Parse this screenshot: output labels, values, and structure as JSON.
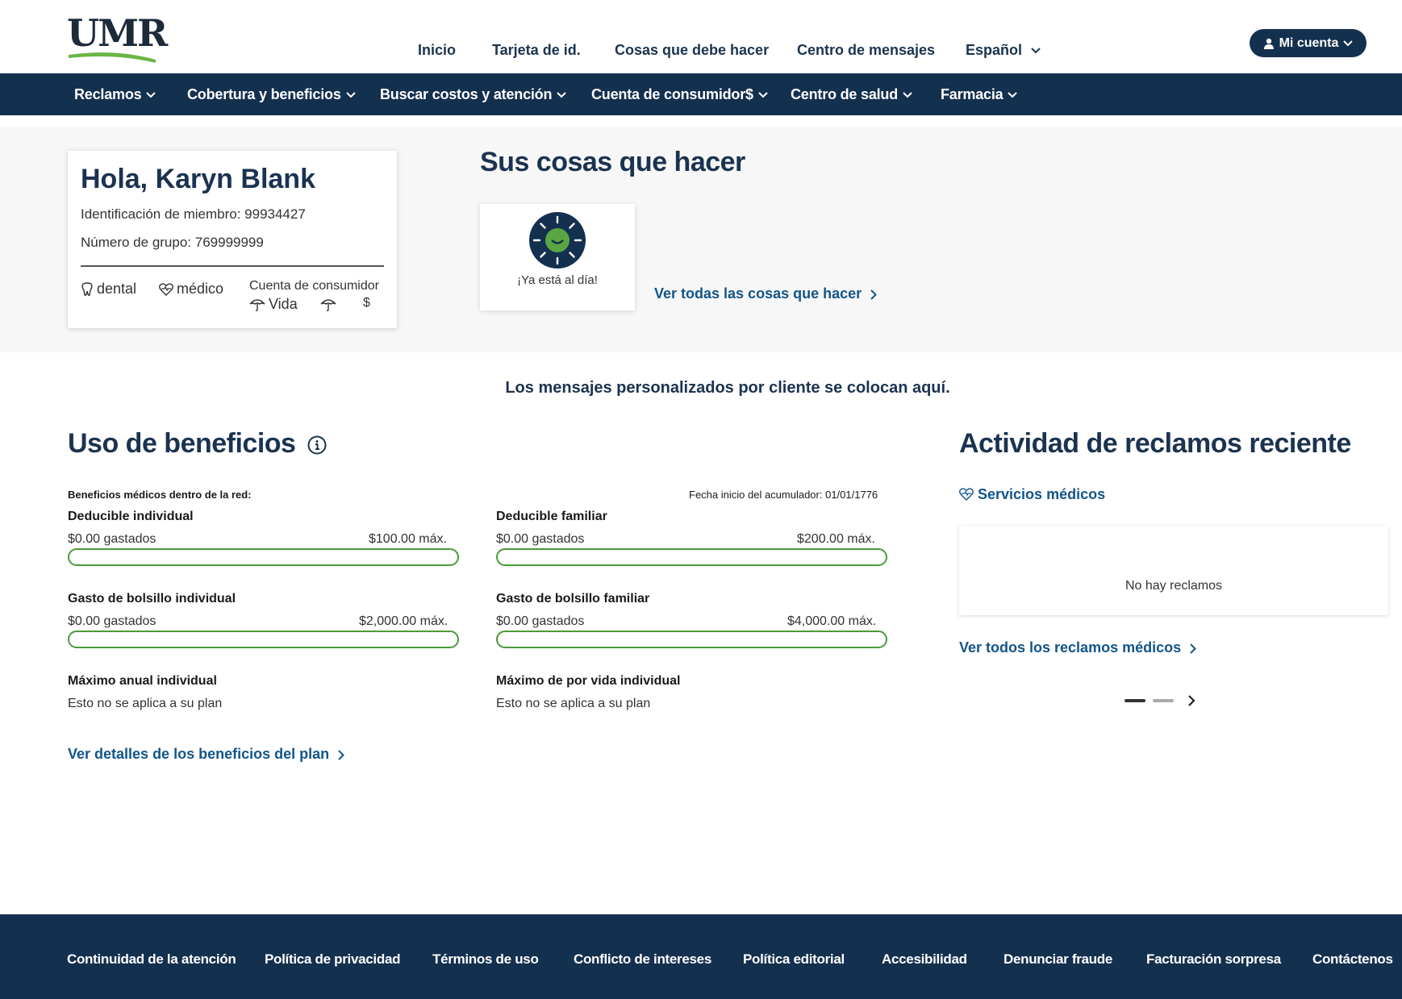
{
  "brand": {
    "logo_text": "UMR",
    "primary_color": "#14304f",
    "accent_green": "#4a9a3a",
    "link_color": "#12558a"
  },
  "topnav": {
    "items": [
      "Inicio",
      "Tarjeta de id.",
      "Cosas que debe hacer",
      "Centro de mensajes",
      "Español"
    ],
    "account_label": "Mi cuenta"
  },
  "mainnav": {
    "items": [
      "Reclamos",
      "Cobertura y beneficios",
      "Buscar costos y atención",
      "Cuenta de consumidor$",
      "Centro de salud",
      "Farmacia"
    ]
  },
  "member": {
    "greeting": "Hola, Karyn Blank",
    "member_id_label": "Identificación de miembro: 99934427",
    "group_label": "Número de grupo: 769999999",
    "coverages": {
      "dental": "dental",
      "medical": "médico",
      "consumer": "Cuenta de consumidor",
      "life": "Vida",
      "dollar": "$"
    }
  },
  "todo": {
    "title": "Sus cosas que hacer",
    "status": "¡Ya está al día!",
    "link": "Ver todas las cosas que hacer"
  },
  "banner": "Los mensajes personalizados por cliente se colocan aquí.",
  "benefits": {
    "title": "Uso de beneficios",
    "network_label": "Beneficios médicos dentro de la red:",
    "accumulator_label": "Fecha inicio del acumulador: 01/01/1776",
    "meters": [
      {
        "title": "Deducible individual",
        "spent": "$0.00 gastados",
        "max": "$100.00 máx.",
        "fraction": 0
      },
      {
        "title": "Deducible familiar",
        "spent": "$0.00 gastados",
        "max": "$200.00 máx.",
        "fraction": 0
      },
      {
        "title": "Gasto de bolsillo individual",
        "spent": "$0.00 gastados",
        "max": "$2,000.00 máx.",
        "fraction": 0
      },
      {
        "title": "Gasto de bolsillo familiar",
        "spent": "$0.00 gastados",
        "max": "$4,000.00 máx.",
        "fraction": 0
      }
    ],
    "annual_max": {
      "title": "Máximo anual individual",
      "note": "Esto no se aplica a su plan"
    },
    "lifetime_max": {
      "title": "Máximo de por vida individual",
      "note": "Esto no se aplica a su plan"
    },
    "link": "Ver detalles de los beneficios del plan"
  },
  "claims": {
    "title": "Actividad de reclamos reciente",
    "tab": "Servicios médicos",
    "empty": "No hay reclamos",
    "link": "Ver todos los reclamos médicos"
  },
  "footer": {
    "links": [
      "Continuidad de la atención",
      "Política de privacidad",
      "Términos de uso",
      "Conflicto de intereses",
      "Política editorial",
      "Accesibilidad",
      "Denunciar fraude",
      "Facturación sorpresa",
      "Contáctenos"
    ]
  }
}
